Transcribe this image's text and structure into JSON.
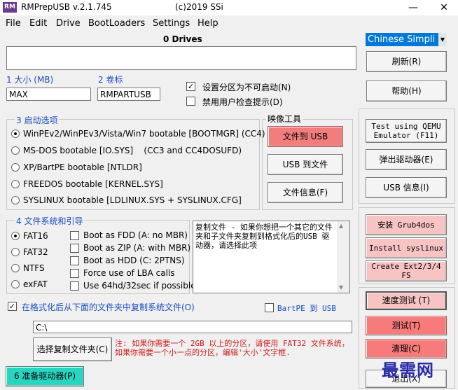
{
  "window": {
    "title": "RMPrepUSB v.2.1.745",
    "copyright": "(c)2019 SSi",
    "icon_text": "RM",
    "minimize": "—",
    "close": "✕"
  },
  "menu": [
    "File",
    "Edit",
    "Drive",
    "BootLoaders",
    "Settings",
    "Help"
  ],
  "drives_header": "0 Drives",
  "language_select": "Chinese Simpli",
  "size_label": "1 大小 (MB)",
  "size_value": "MAX",
  "volume_label": "2 卷标",
  "volume_value": "RMPARTUSB",
  "opt_nonboot": "设置分区为不可启动(N)",
  "opt_disable_prompt": "禁用用户检查提示(D)",
  "boot_group": {
    "title": "3 启动选项",
    "options": [
      "WinPEv2/WinPEv3/Vista/Win7 bootable [BOOTMGR] (CC4)",
      "MS-DOS bootable [IO.SYS]    (CC3 and CC4DOSUFD)",
      "XP/BartPE bootable [NTLDR]",
      "FREEDOS bootable [KERNEL.SYS]",
      "SYSLINUX bootable [LDLINUX.SYS + SYSLINUX.CFG]"
    ]
  },
  "image_tools": {
    "title": "映像工具",
    "file_to_usb": "文件到 USB",
    "usb_to_file": "USB 到文件",
    "file_info": "文件信息(F)"
  },
  "fs_group": {
    "title": "4 文件系统和引导",
    "fs": [
      "FAT16",
      "FAT32",
      "NTFS",
      "exFAT"
    ],
    "boot_opts": [
      "Boot as FDD (A: no MBR)",
      "Boot as ZIP (A: with MBR)",
      "Boot as HDD (C: 2PTNS)",
      "Force use of LBA calls",
      "Use 64hd/32sec if possible"
    ]
  },
  "info_text": "复制文件 - 如果你想把一个其它的文件夹和子文件夹复制到格式化后的USB 驱动器，请选择此项",
  "copy_checkbox": "在格式化后从下面的文件夹中复制系统文件(O)",
  "bartpe_checkbox": "BartPE 到 USB",
  "folder_path": "C:\\",
  "choose_folder": "选择复制文件夹(C)",
  "note": "注: 如果你需要一个 2GB 以上的分区，请使用 FAT32 文件系统，如果你需要一个小一点的分区，编辑'大小'文字框.",
  "prepare_drive": "6 准备驱动器(P)",
  "right": {
    "refresh": "刷新(R)",
    "help": "帮助(H)",
    "qemu": "Test using QEMU Emulator (F11)",
    "eject": "弹出驱动器(E)",
    "usb_info": "USB 信息(I)",
    "install_grub": "安装 Grub4dos",
    "install_syslinux": "Install syslinux",
    "create_ext": "Create Ext2/3/4 FS",
    "speed_test": "速度测试 (T)",
    "test": "测试(T)",
    "clean": "清理(C)",
    "exit": "退出(X)"
  },
  "watermark": "最需网"
}
